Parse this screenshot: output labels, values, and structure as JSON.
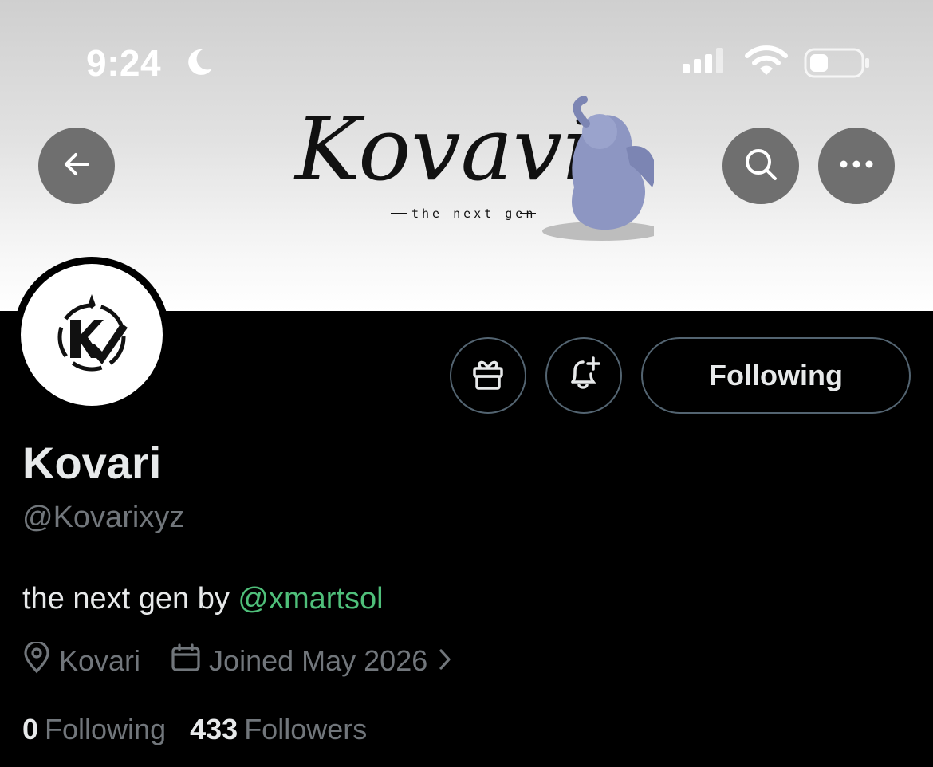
{
  "status_bar": {
    "time": "9:24",
    "icons": [
      "moon-icon",
      "cellular-signal-icon",
      "wifi-icon",
      "battery-icon"
    ]
  },
  "banner": {
    "logo_text": "Kovavi",
    "logo_tagline": "the next gen",
    "gradient": [
      "#cfcfcf",
      "#ffffff"
    ]
  },
  "nav": {
    "back_icon": "arrow-left-icon",
    "search_icon": "search-icon",
    "more_icon": "more-horizontal-icon"
  },
  "profile": {
    "display_name": "Kovari",
    "handle": "@Kovarixyz",
    "bio_text": "the next gen by ",
    "bio_mention": "@xmartsol",
    "location": "Kovari",
    "joined": "Joined May 2026",
    "following_count": "0",
    "following_label": "Following",
    "followers_count": "433",
    "followers_label": "Followers"
  },
  "actions": {
    "gift_icon": "gift-icon",
    "notify_icon": "bell-plus-icon",
    "following_button": "Following"
  },
  "colors": {
    "background": "#000000",
    "text_primary": "#e7e9ea",
    "text_secondary": "#71767b",
    "mention": "#4fbf7a",
    "border": "#536471"
  }
}
